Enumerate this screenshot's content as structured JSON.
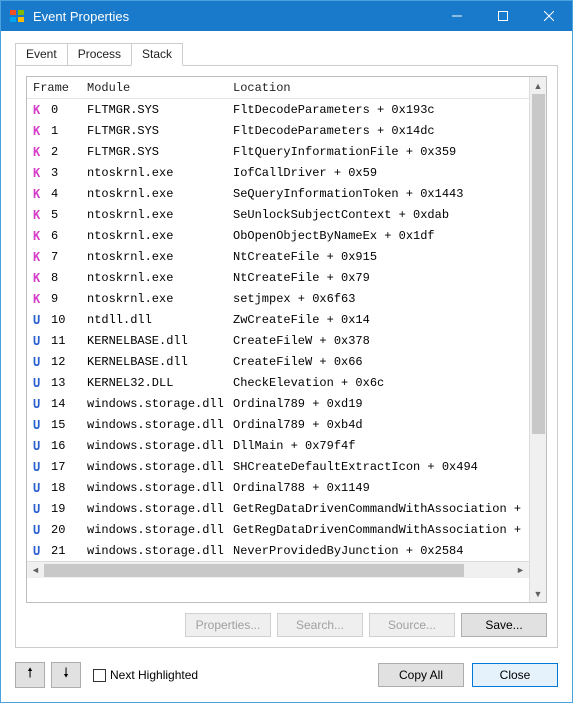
{
  "window": {
    "title": "Event Properties"
  },
  "tabs": {
    "event": "Event",
    "process": "Process",
    "stack": "Stack",
    "active": "stack"
  },
  "columns": {
    "frame": "Frame",
    "module": "Module",
    "location": "Location"
  },
  "stack": [
    {
      "mode": "K",
      "n": 0,
      "module": "FLTMGR.SYS",
      "location": "FltDecodeParameters + 0x193c"
    },
    {
      "mode": "K",
      "n": 1,
      "module": "FLTMGR.SYS",
      "location": "FltDecodeParameters + 0x14dc"
    },
    {
      "mode": "K",
      "n": 2,
      "module": "FLTMGR.SYS",
      "location": "FltQueryInformationFile + 0x359"
    },
    {
      "mode": "K",
      "n": 3,
      "module": "ntoskrnl.exe",
      "location": "IofCallDriver + 0x59"
    },
    {
      "mode": "K",
      "n": 4,
      "module": "ntoskrnl.exe",
      "location": "SeQueryInformationToken + 0x1443"
    },
    {
      "mode": "K",
      "n": 5,
      "module": "ntoskrnl.exe",
      "location": "SeUnlockSubjectContext + 0xdab"
    },
    {
      "mode": "K",
      "n": 6,
      "module": "ntoskrnl.exe",
      "location": "ObOpenObjectByNameEx + 0x1df"
    },
    {
      "mode": "K",
      "n": 7,
      "module": "ntoskrnl.exe",
      "location": "NtCreateFile + 0x915"
    },
    {
      "mode": "K",
      "n": 8,
      "module": "ntoskrnl.exe",
      "location": "NtCreateFile + 0x79"
    },
    {
      "mode": "K",
      "n": 9,
      "module": "ntoskrnl.exe",
      "location": "setjmpex + 0x6f63"
    },
    {
      "mode": "U",
      "n": 10,
      "module": "ntdll.dll",
      "location": "ZwCreateFile + 0x14"
    },
    {
      "mode": "U",
      "n": 11,
      "module": "KERNELBASE.dll",
      "location": "CreateFileW + 0x378"
    },
    {
      "mode": "U",
      "n": 12,
      "module": "KERNELBASE.dll",
      "location": "CreateFileW + 0x66"
    },
    {
      "mode": "U",
      "n": 13,
      "module": "KERNEL32.DLL",
      "location": "CheckElevation + 0x6c"
    },
    {
      "mode": "U",
      "n": 14,
      "module": "windows.storage.dll",
      "location": "Ordinal789 + 0xd19"
    },
    {
      "mode": "U",
      "n": 15,
      "module": "windows.storage.dll",
      "location": "Ordinal789 + 0xb4d"
    },
    {
      "mode": "U",
      "n": 16,
      "module": "windows.storage.dll",
      "location": "DllMain + 0x79f4f"
    },
    {
      "mode": "U",
      "n": 17,
      "module": "windows.storage.dll",
      "location": "SHCreateDefaultExtractIcon + 0x494"
    },
    {
      "mode": "U",
      "n": 18,
      "module": "windows.storage.dll",
      "location": "Ordinal788 + 0x1149"
    },
    {
      "mode": "U",
      "n": 19,
      "module": "windows.storage.dll",
      "location": "GetRegDataDrivenCommandWithAssociation +"
    },
    {
      "mode": "U",
      "n": 20,
      "module": "windows.storage.dll",
      "location": "GetRegDataDrivenCommandWithAssociation +"
    },
    {
      "mode": "U",
      "n": 21,
      "module": "windows.storage.dll",
      "location": "NeverProvidedByJunction + 0x2584"
    }
  ],
  "actions": {
    "properties": "Properties...",
    "search": "Search...",
    "source": "Source...",
    "save": "Save..."
  },
  "footer": {
    "next_highlighted": "Next Highlighted",
    "copy_all": "Copy All",
    "close": "Close"
  }
}
